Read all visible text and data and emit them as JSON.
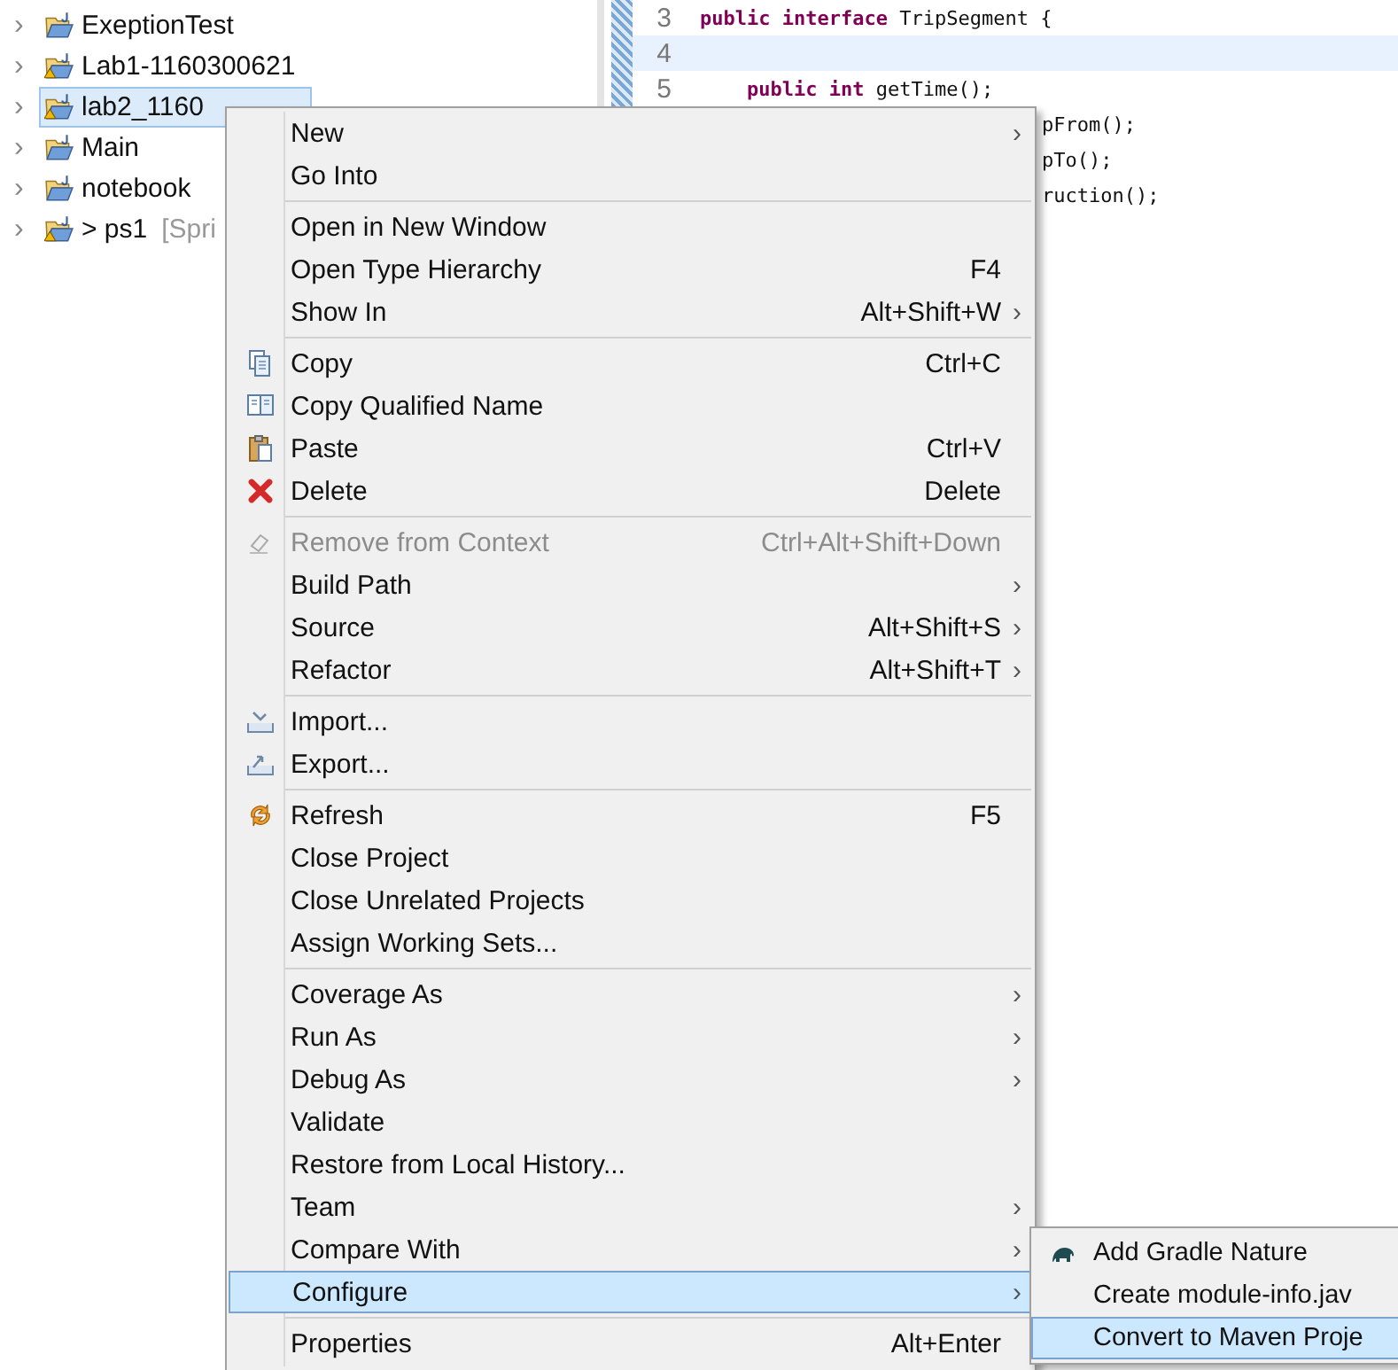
{
  "project_tree": {
    "items": [
      {
        "chevron": "›",
        "name": "ExeptionTest",
        "warning": false,
        "selected": false
      },
      {
        "chevron": "›",
        "name": "Lab1-1160300621",
        "warning": true,
        "selected": false
      },
      {
        "chevron": "›",
        "name": "lab2_1160",
        "warning": true,
        "selected": true
      },
      {
        "chevron": "›",
        "name": "Main",
        "warning": false,
        "selected": false
      },
      {
        "chevron": "›",
        "name": "notebook",
        "warning": false,
        "selected": false
      },
      {
        "chevron": "›",
        "name": "> ps1",
        "decoration": "[Spri",
        "warning": true,
        "selected": false
      }
    ]
  },
  "editor": {
    "lines": [
      {
        "kind": "full",
        "number": "3",
        "current": false,
        "tokens": [
          {
            "kind": "keyword",
            "text": "public"
          },
          {
            "kind": "keyword",
            "text": " interface"
          },
          {
            "kind": "plain",
            "text": " TripSegment {"
          }
        ]
      },
      {
        "kind": "full",
        "number": "4",
        "current": true
      },
      {
        "kind": "indented",
        "number": "5",
        "current": false,
        "tokens": [
          {
            "kind": "keyword",
            "text": "public"
          },
          {
            "kind": "keyword",
            "text": " int"
          },
          {
            "kind": "plain",
            "text": " getTime();"
          }
        ]
      },
      {
        "kind": "partial",
        "current": false,
        "tokens": [
          {
            "kind": "plain",
            "text": "pFrom();"
          }
        ]
      },
      {
        "kind": "partial",
        "current": false,
        "tokens": [
          {
            "kind": "plain",
            "text": "pTo();"
          }
        ]
      },
      {
        "kind": "partial",
        "current": false,
        "tokens": [
          {
            "kind": "plain",
            "text": "ruction();"
          }
        ]
      }
    ]
  },
  "context_menu": {
    "groups": [
      [
        {
          "label": "New",
          "arrow": "›",
          "disabled": false,
          "selected": false
        },
        {
          "label": "Go Into",
          "disabled": false,
          "selected": false
        }
      ],
      [
        {
          "label": "Open in New Window",
          "disabled": false,
          "selected": false
        },
        {
          "label": "Open Type Hierarchy",
          "shortcut": "F4",
          "disabled": false,
          "selected": false
        },
        {
          "label": "Show In",
          "shortcut": "Alt+Shift+W",
          "arrow": "›",
          "disabled": false,
          "selected": false
        }
      ],
      [
        {
          "label": "Copy",
          "shortcut": "Ctrl+C",
          "kind": "copy",
          "disabled": false,
          "selected": false
        },
        {
          "label": "Copy Qualified Name",
          "kind": "copy-qualified",
          "disabled": false,
          "selected": false
        },
        {
          "label": "Paste",
          "shortcut": "Ctrl+V",
          "kind": "paste",
          "disabled": false,
          "selected": false
        },
        {
          "label": "Delete",
          "shortcut": "Delete",
          "kind": "delete",
          "disabled": false,
          "selected": false
        }
      ],
      [
        {
          "label": "Remove from Context",
          "shortcut": "Ctrl+Alt+Shift+Down",
          "kind": "context",
          "disabled": true,
          "selected": false
        },
        {
          "label": "Build Path",
          "arrow": "›",
          "disabled": false,
          "selected": false
        },
        {
          "label": "Source",
          "shortcut": "Alt+Shift+S",
          "arrow": "›",
          "disabled": false,
          "selected": false
        },
        {
          "label": "Refactor",
          "shortcut": "Alt+Shift+T",
          "arrow": "›",
          "disabled": false,
          "selected": false
        }
      ],
      [
        {
          "label": "Import...",
          "kind": "import",
          "disabled": false,
          "selected": false
        },
        {
          "label": "Export...",
          "kind": "export",
          "disabled": false,
          "selected": false
        }
      ],
      [
        {
          "label": "Refresh",
          "shortcut": "F5",
          "kind": "refresh",
          "disabled": false,
          "selected": false
        },
        {
          "label": "Close Project",
          "disabled": false,
          "selected": false
        },
        {
          "label": "Close Unrelated Projects",
          "disabled": false,
          "selected": false
        },
        {
          "label": "Assign Working Sets...",
          "disabled": false,
          "selected": false
        }
      ],
      [
        {
          "label": "Coverage As",
          "arrow": "›",
          "disabled": false,
          "selected": false
        },
        {
          "label": "Run As",
          "arrow": "›",
          "disabled": false,
          "selected": false
        },
        {
          "label": "Debug As",
          "arrow": "›",
          "disabled": false,
          "selected": false
        },
        {
          "label": "Validate",
          "disabled": false,
          "selected": false
        },
        {
          "label": "Restore from Local History...",
          "disabled": false,
          "selected": false
        },
        {
          "label": "Team",
          "arrow": "›",
          "disabled": false,
          "selected": false
        },
        {
          "label": "Compare With",
          "arrow": "›",
          "disabled": false,
          "selected": false
        },
        {
          "label": "Configure",
          "arrow": "›",
          "disabled": false,
          "selected": true
        }
      ],
      [
        {
          "label": "Properties",
          "shortcut": "Alt+Enter",
          "disabled": false,
          "selected": false
        }
      ]
    ]
  },
  "submenu": {
    "items": [
      {
        "label": "Add Gradle Nature",
        "kind": "gradle",
        "selected": false
      },
      {
        "label": "Create module-info.jav",
        "selected": false
      },
      {
        "label": "Convert to Maven Proje",
        "selected": true
      }
    ]
  }
}
